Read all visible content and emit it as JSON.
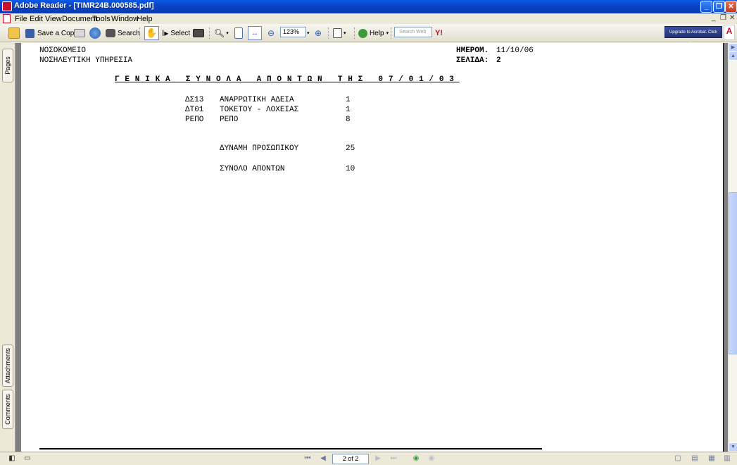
{
  "window": {
    "title": "Adobe Reader - [TIMR24B.000585.pdf]"
  },
  "menu": [
    "File",
    "Edit",
    "View",
    "Document",
    "Tools",
    "Window",
    "Help"
  ],
  "toolbar": {
    "save_copy": "Save a Copy",
    "search": "Search",
    "select": "Select",
    "zoom_value": "123%",
    "help": "Help",
    "search_web_placeholder": "Search Web",
    "yahoo": "Y!",
    "upgrade": "Upgrade to Acrobat. Click Here",
    "adobe_logo": "A"
  },
  "side_tabs": {
    "pages": "Pages",
    "attachments": "Attachments",
    "comments": "Comments"
  },
  "document": {
    "org": "ΝΟΣΟΚΟΜΕΙΟ",
    "department": "ΝΟΣΗΛΕΥΤΙΚΗ ΥΠΗΡΕΣΙΑ",
    "date_label": "ΗΜΕΡΟΜ.",
    "date_value": "11/10/06",
    "page_label": "ΣΕΛΙΔΑ:",
    "page_value": "2",
    "heading": "ΓΕΝΙΚΑ ΣΥΝΟΛΑ ΑΠΟΝΤΩΝ ΤΗΣ 07/01/03",
    "rows": [
      {
        "code": "ΔΣ13",
        "desc": "ΑΝΑΡΡΩΤΙΚΗ ΑΔΕΙΑ",
        "count": "1"
      },
      {
        "code": "ΔΤ01",
        "desc": "ΤΟΚΕΤΟΥ - ΛΟΧΕΙΑΣ",
        "count": "1"
      },
      {
        "code": "ΡΕΠΟ",
        "desc": "ΡΕΠΟ",
        "count": "8"
      }
    ],
    "staff_label": "ΔΥΝΑΜΗ ΠΡΟΣΩΠΙΚΟΥ",
    "staff_value": "25",
    "absent_label": "ΣΥΝΟΛΟ ΑΠΟΝΤΩΝ",
    "absent_value": "10"
  },
  "status": {
    "page_indicator": "2 of 2"
  }
}
